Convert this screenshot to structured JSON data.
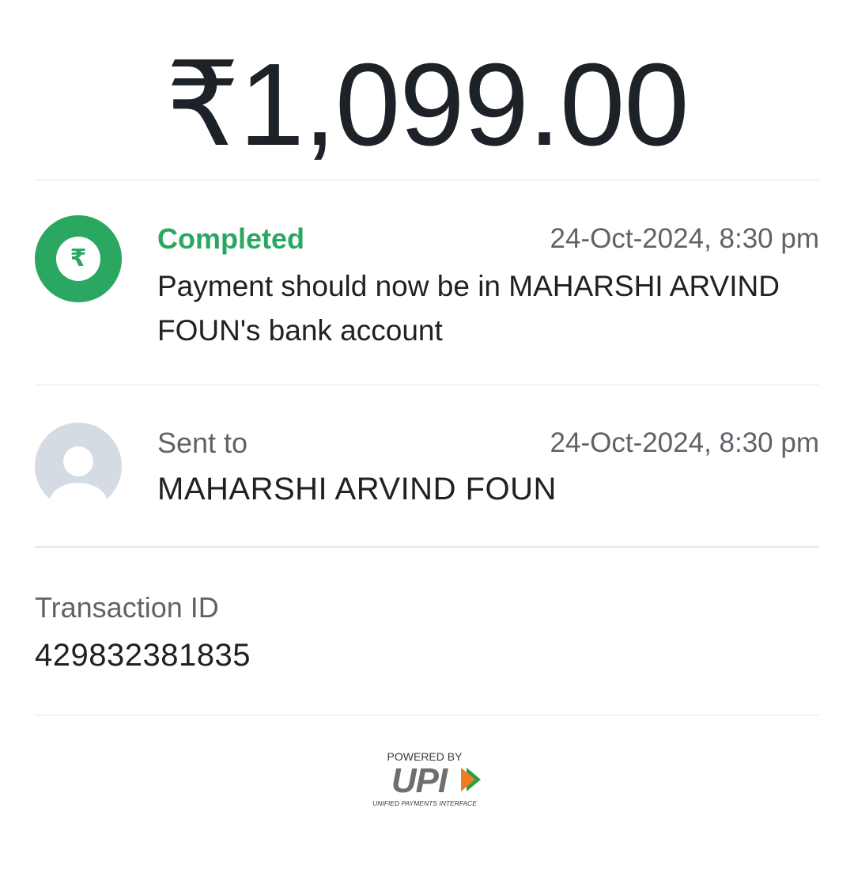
{
  "amount": "₹1,099.00",
  "status": {
    "label": "Completed",
    "timestamp": "24-Oct-2024, 8:30 pm",
    "message": "Payment should now be in MAHARSHI ARVIND FOUN's bank account",
    "icon": "rupee-icon",
    "color": "#2aa760"
  },
  "recipient": {
    "label": "Sent to",
    "timestamp": "24-Oct-2024, 8:30 pm",
    "name": "MAHARSHI ARVIND FOUN",
    "icon": "person-icon"
  },
  "transaction": {
    "label": "Transaction ID",
    "id": "429832381835"
  },
  "footer": {
    "powered_by": "POWERED BY",
    "brand": "UPI",
    "tagline": "UNIFIED PAYMENTS INTERFACE"
  }
}
